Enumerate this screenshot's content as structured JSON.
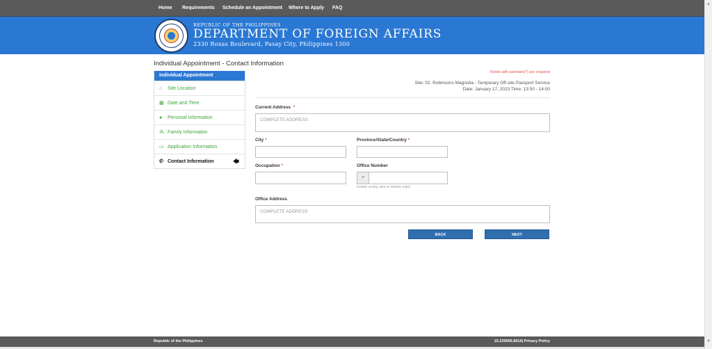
{
  "nav": {
    "items": [
      "Home",
      "Requirements",
      "Schedule an Appointment",
      "Where to Apply",
      "FAQ"
    ]
  },
  "banner": {
    "republic": "REPUBLIC OF THE PHILIPPINES",
    "department": "DEPARTMENT OF FOREIGN AFFAIRS",
    "address": "2330 Roxas Boulevard, Pasay City, Philippines 1300"
  },
  "page_title": "Individual Appointment - Contact Information",
  "sidebar": {
    "header": "Individual Appointment",
    "items": [
      {
        "label": "Site Location",
        "icon": "home-icon"
      },
      {
        "label": "Date and Time",
        "icon": "calendar-icon"
      },
      {
        "label": "Personal Information",
        "icon": "person-icon"
      },
      {
        "label": "Family Information",
        "icon": "users-icon"
      },
      {
        "label": "Application Information",
        "icon": "card-icon"
      },
      {
        "label": "Contact Information",
        "icon": "phone-icon",
        "active": true
      }
    ],
    "active_arrow": "🡄"
  },
  "form": {
    "required_note": "Fields with asterisks(*) are required",
    "site": "Site: 02. Robinsons Magnolia - Temporary Off-site Passport Service",
    "date": "Date: January 17, 2023   Time: 13:00 - 14:00",
    "current_address": {
      "label": "Current Address",
      "required": "*",
      "placeholder": "COMPLETE ADDRESS",
      "value": ""
    },
    "city": {
      "label": "City",
      "required": "*",
      "value": ""
    },
    "province": {
      "label": "Province/State/Country",
      "required": "*",
      "value": ""
    },
    "occupation": {
      "label": "Occupation",
      "required": "*",
      "value": ""
    },
    "office_number": {
      "label": "Office Number",
      "prefix": "+",
      "hint": "include country, area or network codes",
      "value": ""
    },
    "office_address": {
      "label": "Office Address",
      "placeholder": "COMPLETE ADDRESS",
      "value": ""
    },
    "back_label": "BACK",
    "next_label": "NEXT"
  },
  "footer": {
    "left": "Republic of the Philippines",
    "right": "22.220906.8016| Privacy Policy"
  },
  "colors": {
    "accent": "#2a78d3",
    "nav_bg": "#5a5a5a",
    "sidebar_link": "#3aa63a",
    "required": "#d9534f",
    "button": "#2f6fb0"
  }
}
